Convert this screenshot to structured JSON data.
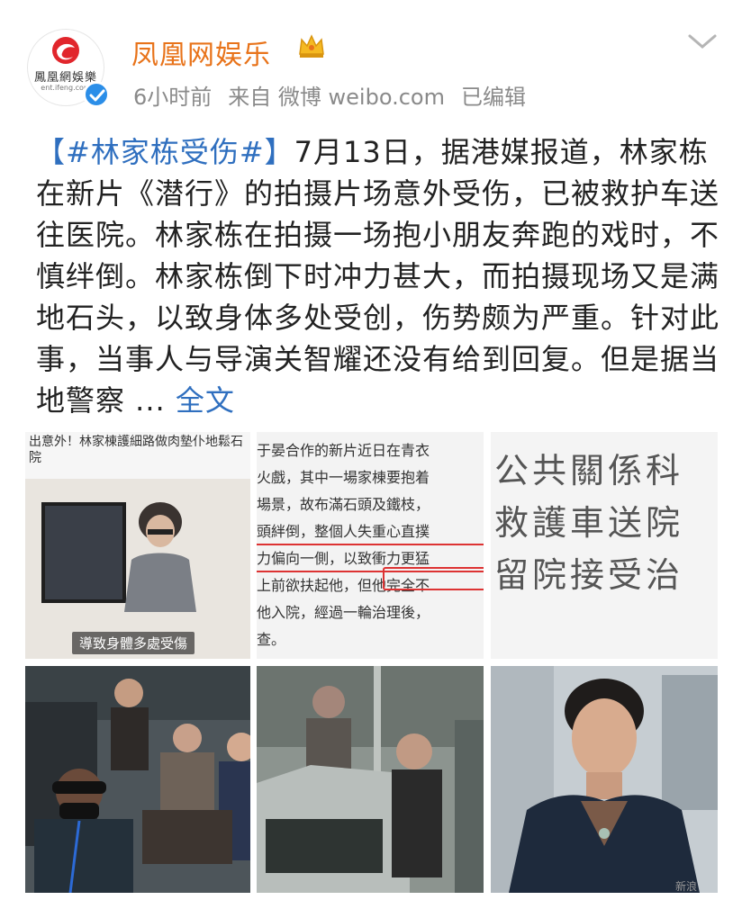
{
  "account": {
    "name": "凤凰网娱乐",
    "logo_text": "鳳凰網娛樂",
    "logo_url": "ent.ifeng.com",
    "time": "6小时前",
    "source": "来自 微博 weibo.com",
    "edited": "已编辑"
  },
  "post": {
    "hashtag": "【#林家栋受伤#】",
    "body": "7月13日，据港媒报道，林家栋在新片《潜行》的拍摄片场意外受伤，已被救护车送往医院。林家栋在拍摄一场抱小朋友奔跑的戏时，不慎绊倒。林家栋倒下时冲力甚大，而拍摄现场又是满地石头，以致身体多处受创，伤势颇为严重。针对此事，当事人与导演关智耀还没有给到回复。但是据当地警察 ...",
    "more": "全文"
  },
  "images": {
    "img1": {
      "headline": "出意外！林家棟護細路做肉墊仆地鬆石 院",
      "caption": "導致身體多處受傷"
    },
    "img2": {
      "lines": [
        "于晏合作的新片近日在青衣",
        "火戲，其中一場家棟要抱着",
        "場景，故布滿石頭及鐵枝，",
        "頭絆倒，整個人失重心直撲",
        "力偏向一側，以致衝力更猛",
        "上前欲扶起他，但他完全不",
        "他入院，經過一輪治理後，",
        "查。"
      ]
    },
    "img3": {
      "lines": [
        "公共關係科",
        "救護車送院",
        "留院接受治"
      ]
    }
  },
  "watermark": "新浪"
}
